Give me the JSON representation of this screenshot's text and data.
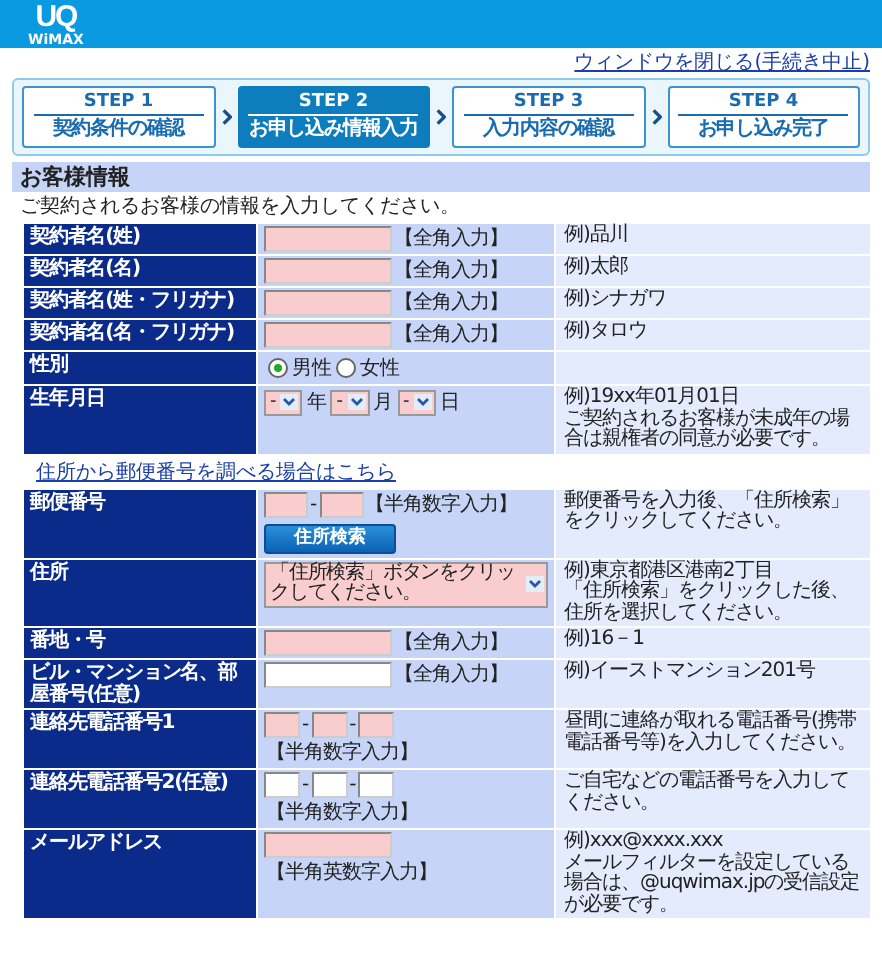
{
  "header": {
    "logo": "UQ",
    "logo_sub": "WiMAX"
  },
  "close_link": "ウィンドウを閉じる(手続き中止)",
  "steps": [
    {
      "step": "STEP 1",
      "label": "契約条件の確認",
      "selected": false
    },
    {
      "step": "STEP 2",
      "label": "お申し込み情報入力",
      "selected": true
    },
    {
      "step": "STEP 3",
      "label": "入力内容の確認",
      "selected": false
    },
    {
      "step": "STEP 4",
      "label": "お申し込み完了",
      "selected": false
    }
  ],
  "section_title": "お客様情報",
  "intro": "ご契約されるお客様の情報を入力してください。",
  "form_1": {
    "rows": [
      {
        "label": "契約者名(姓)",
        "kind": "text",
        "fields": [
          {
            "required": true
          }
        ],
        "note": "【全角入力】",
        "hint": [
          "例)品川"
        ]
      },
      {
        "label": "契約者名(名)",
        "kind": "text",
        "fields": [
          {
            "required": true
          }
        ],
        "note": "【全角入力】",
        "hint": [
          "例)太郎"
        ]
      },
      {
        "label": "契約者名(姓・フリガナ)",
        "kind": "text",
        "fields": [
          {
            "required": true
          }
        ],
        "note": "【全角入力】",
        "hint": [
          "例)シナガワ"
        ]
      },
      {
        "label": "契約者名(名・フリガナ)",
        "kind": "text",
        "fields": [
          {
            "required": true
          }
        ],
        "note": "【全角入力】",
        "hint": [
          "例)タロウ"
        ]
      },
      {
        "label": "性別",
        "kind": "radio",
        "options": [
          {
            "label": "男性",
            "selected": true
          },
          {
            "label": "女性",
            "selected": false
          }
        ]
      },
      {
        "label": "生年月日",
        "kind": "date",
        "parts": [
          {
            "value": "-",
            "unit": "年",
            "required": true
          },
          {
            "value": "-",
            "unit": "月",
            "required": true
          },
          {
            "value": "-",
            "unit": "日",
            "required": true
          }
        ],
        "hint": [
          "例)19xx年01月01日",
          "ご契約されるお客様が未成年の場合は親権者の同意が必要です。"
        ]
      }
    ]
  },
  "postal_lookup_link": "住所から郵便番号を調べる場合はこちら",
  "form_2": {
    "rows": [
      {
        "label": "郵便番号",
        "kind": "postal",
        "fields": [
          {
            "required": true
          },
          {
            "required": true
          }
        ],
        "separator": "-",
        "note": "【半角数字入力】",
        "button": "住所検索",
        "hint": [
          "郵便番号を入力後、「住所検索」をクリックしてください。"
        ]
      },
      {
        "label": "住所",
        "kind": "select",
        "value": "「住所検索」ボタンをクリックしてください。",
        "required": true,
        "hint": [
          "例)東京都港区港南2丁目",
          "「住所検索」をクリックした後、住所を選択してください。"
        ]
      },
      {
        "label": "番地・号",
        "kind": "text",
        "fields": [
          {
            "required": true
          }
        ],
        "note": "【全角入力】",
        "hint": [
          "例)16－1"
        ]
      },
      {
        "label": "ビル・マンション名、部屋番号(任意)",
        "kind": "text",
        "fields": [
          {
            "required": false
          }
        ],
        "note": "【全角入力】",
        "hint": [
          "例)イーストマンション201号"
        ]
      },
      {
        "label": "連絡先電話番号1",
        "kind": "phone",
        "fields": [
          {
            "required": true
          },
          {
            "required": true
          },
          {
            "required": true
          }
        ],
        "separator": "-",
        "note": "【半角数字入力】",
        "hint": [
          "昼間に連絡が取れる電話番号(携帯電話番号等)を入力してください。"
        ]
      },
      {
        "label": "連絡先電話番号2(任意)",
        "kind": "phone",
        "fields": [
          {
            "required": false
          },
          {
            "required": false
          },
          {
            "required": false
          }
        ],
        "separator": "-",
        "note": "【半角数字入力】",
        "hint": [
          "ご自宅などの電話番号を入力してください。"
        ]
      },
      {
        "label": "メールアドレス",
        "kind": "text",
        "fields": [
          {
            "required": true
          }
        ],
        "note": "【半角英数字入力】",
        "hint": [
          "例)xxx@xxxx.xxx",
          "メールフィルターを設定している場合は、@uqwimax.jpの受信設定が必要です。"
        ]
      }
    ]
  }
}
